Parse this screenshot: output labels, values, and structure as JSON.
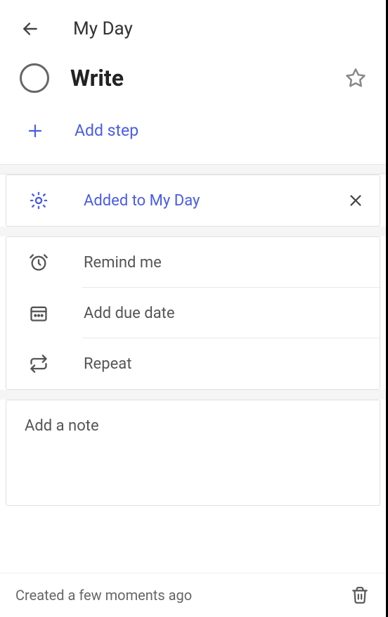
{
  "header": {
    "title": "My Day"
  },
  "task": {
    "title": "Write"
  },
  "addStep": {
    "label": "Add step"
  },
  "myDay": {
    "label": "Added to My Day"
  },
  "options": {
    "remind": "Remind me",
    "dueDate": "Add due date",
    "repeat": "Repeat"
  },
  "note": {
    "placeholder": "Add a note"
  },
  "footer": {
    "created": "Created a few moments ago"
  },
  "colors": {
    "accent": "#4a5ce6",
    "text": "#555",
    "iconGray": "#666"
  }
}
